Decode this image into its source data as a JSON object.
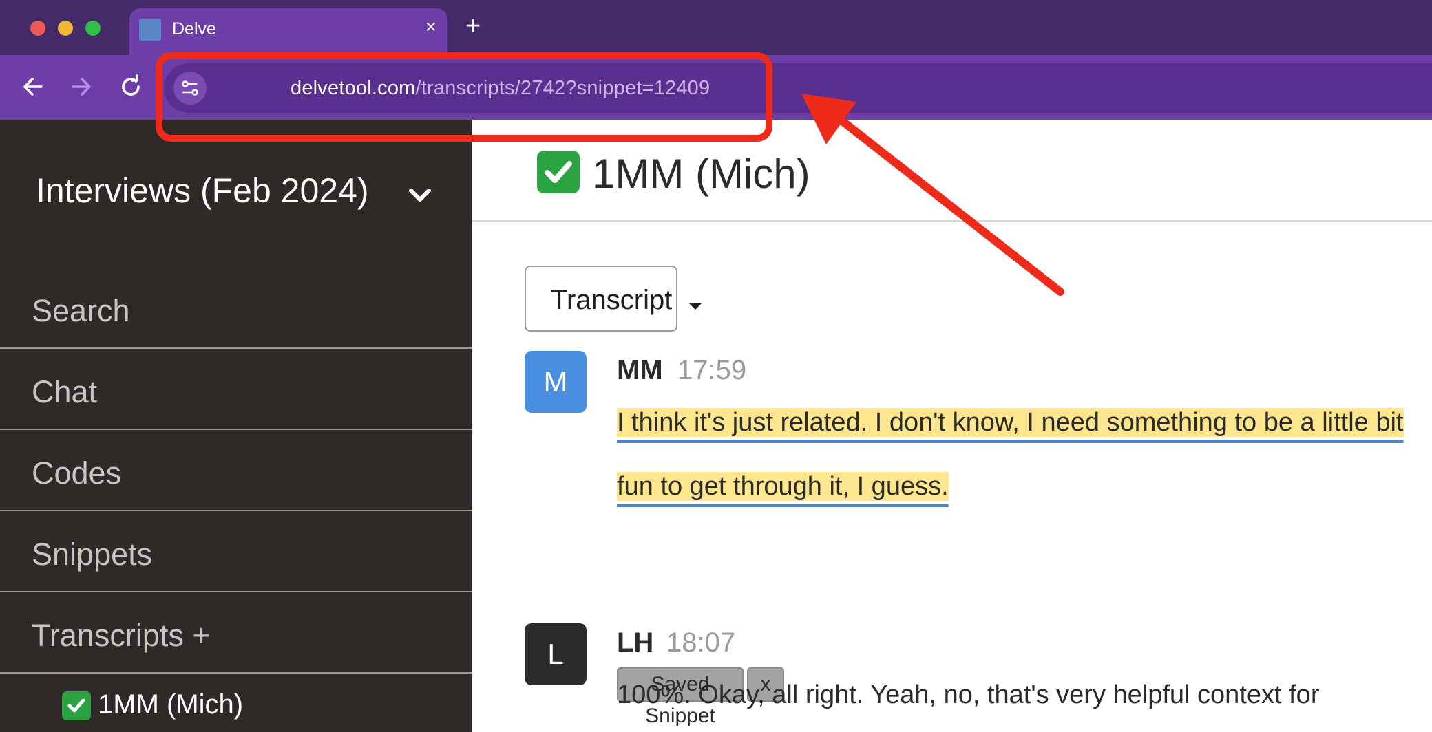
{
  "browser": {
    "tab_title": "Delve",
    "tab_close": "×",
    "new_tab": "+",
    "url_host": "delvetool.com",
    "url_path": "/transcripts/2742?snippet=12409"
  },
  "sidebar": {
    "project_title": "Interviews (Feb 2024)",
    "items": [
      {
        "label": "Search"
      },
      {
        "label": "Chat"
      },
      {
        "label": "Codes"
      },
      {
        "label": "Snippets"
      },
      {
        "label": "Transcripts +"
      }
    ],
    "transcript_item": "1MM (Mich)"
  },
  "main": {
    "title": "1MM (Mich)",
    "view_dropdown": "Transcript",
    "messages": [
      {
        "avatar": "M",
        "avatar_color": "#4a8ee0",
        "speaker": "MM",
        "time": "17:59",
        "text": "I think it's just related. I don't know, I need something to be a little bit fun to get through it, I guess.",
        "tag": "Saved Snippet",
        "tag_remove": "x"
      },
      {
        "avatar": "L",
        "avatar_color": "#2c2c2c",
        "speaker": "LH",
        "time": "18:07",
        "text": "100%. Okay, all right. Yeah, no, that's very helpful context for"
      }
    ]
  },
  "colors": {
    "tabbar": "#452a6a",
    "toolbar": "#6d3da8",
    "sidebar": "#2f2a27",
    "annotation": "#ee2a1b",
    "highlight": "#fde68d"
  }
}
